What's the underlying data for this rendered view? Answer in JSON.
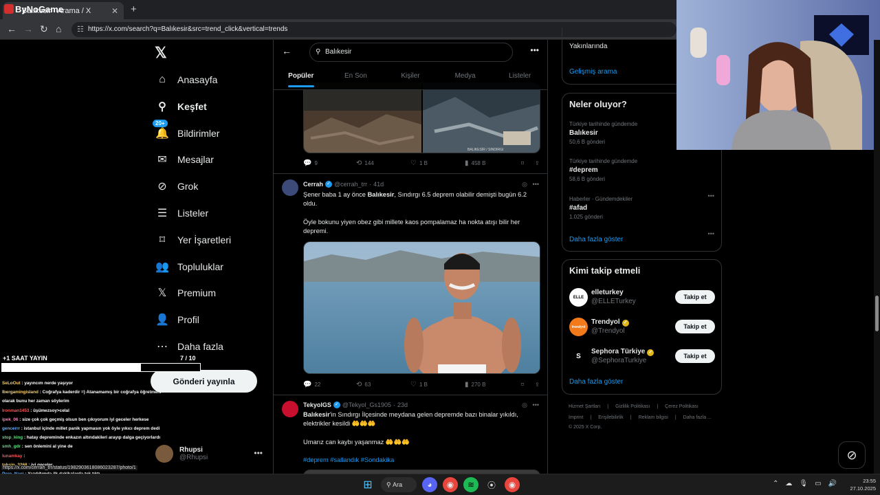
{
  "browser": {
    "tab_title": "Balıkesir - Arama / X",
    "url": "https://x.com/search?q=Balıkesir&src=trend_click&vertical=trends",
    "brand_logo_text": "ByNoGame"
  },
  "nav": {
    "items": [
      {
        "label": "Anasayfa",
        "icon": "home-icon"
      },
      {
        "label": "Keşfet",
        "icon": "search-icon"
      },
      {
        "label": "Bildirimler",
        "icon": "bell-icon",
        "badge": "20+"
      },
      {
        "label": "Mesajlar",
        "icon": "mail-icon"
      },
      {
        "label": "Grok",
        "icon": "grok-icon"
      },
      {
        "label": "Listeler",
        "icon": "list-icon"
      },
      {
        "label": "Yer İşaretleri",
        "icon": "bookmark-icon"
      },
      {
        "label": "Topluluklar",
        "icon": "communities-icon"
      },
      {
        "label": "Premium",
        "icon": "x-icon"
      },
      {
        "label": "Profil",
        "icon": "person-icon"
      },
      {
        "label": "Daha fazla",
        "icon": "more-circle-icon"
      }
    ],
    "post_button": "Gönderi yayınla",
    "account": {
      "name": "Rhupsi",
      "handle": "@Rhupsi"
    }
  },
  "overlay": {
    "title": "+1 SAAT YAYIN",
    "count": "7  / 10",
    "progress": 0.7,
    "chat": [
      {
        "user": "SeLoOut",
        "msg": "yayıncım nerde yaşıyor",
        "color": "u"
      },
      {
        "user": "Ibergamingisland",
        "msg": "Coğrafya kaderdir =) Atanamamış bir coğrafya öğretmeni",
        "color": "u"
      },
      {
        "user": "",
        "msg": "olarak bunu her zaman söylerim",
        "color": "u"
      },
      {
        "user": "Ironman1453",
        "msg": "üşümezsoy>celal",
        "color": "u r"
      },
      {
        "user": "ipek_06",
        "msg": "size çok çok geçmiş olsun ben çıkıyorum iyi geceler herkese",
        "color": "u p"
      },
      {
        "user": "gencerrr",
        "msg": "istanbul içinde millet panik yapmasın yok öyle yıkıcı deprem dedi",
        "color": "u b"
      },
      {
        "user": "stop_king",
        "msg": "hatay depreminde enkazın altındakileri arayıp dalga geçiyorlardı",
        "color": "u g"
      },
      {
        "user": "smh_gdr",
        "msg": "sen önlemini al yine de",
        "color": "u g"
      },
      {
        "user": "lunamkay",
        "msg": "",
        "color": "u r"
      },
      {
        "user": "tahsin_3268",
        "msg": "iyi geceler",
        "color": "u"
      },
      {
        "user": "Pero_Nagi",
        "msg": "Yazdığımda ilk dakikalarda tek tıktı",
        "color": "u b"
      },
      {
        "user": "smh_gdr",
        "msg": "ohoo neler neler yaptılar",
        "color": "u g"
      },
      {
        "user": "ipek_06",
        "msg": "iyi geceler",
        "color": "u p"
      }
    ],
    "url_tip": "https://x.com/cerrah_trr/status/1982903618086023287/photo/1"
  },
  "search": {
    "query": "Balıkesir",
    "tabs": [
      "Popüler",
      "En Son",
      "Kişiler",
      "Medya",
      "Listeler"
    ]
  },
  "tweets": [
    {
      "replies": "9",
      "retweets": "144",
      "likes": "1 B",
      "views": "458 B",
      "image_caption": "BALIKESİR / SINDIRGI"
    },
    {
      "name": "Cerrah",
      "handle": "@cerrah_trr",
      "time": "41d",
      "text1_pre": "Şener baba 1 ay önce ",
      "text1_bold": "Balıkesir",
      "text1_post": ", Sındırgı 6.5 deprem olabilir demişti bugün 6.2 oldu.",
      "text2": "Öyle bokunu yiyen obez gibi millete kaos pompalamaz ha nokta atışı bilir her depremi.",
      "replies": "22",
      "retweets": "63",
      "likes": "1 B",
      "views": "270 B"
    },
    {
      "name": "TekyolGS",
      "handle": "@Tekyol_Gs1905",
      "time": "23d",
      "text1_bold": "Balıkesir",
      "text1_post": "'in Sındırgı İlçesinde meydana gelen depremde bazı binalar yıkıldı, elektrikler kesildi 🤲🤲🤲",
      "text2": "Umarız can kaybı yaşanmaz 🤲🤲🤲",
      "hashtags": "#deprem #sallandık #Sondakika"
    }
  ],
  "right": {
    "top_text": "Yakınlarında",
    "advanced": "Gelişmiş arama",
    "trends_title": "Neler oluyor?",
    "trends": [
      {
        "context": "Türkiye tarihinde gündemde",
        "name": "Balıkesir",
        "posts": "50,6 B gönderi"
      },
      {
        "context": "Türkiye tarihinde gündemde",
        "name": "#deprem",
        "posts": "58,6 B gönderi"
      },
      {
        "context": "Haberler · Gündemdekiler",
        "name": "#afad",
        "posts": "1.025 gönderi"
      }
    ],
    "show_more": "Daha fazla göster",
    "who_title": "Kimi takip etmeli",
    "who": [
      {
        "name": "elleturkey",
        "handle": "@ELLETurkey",
        "button": "Takip et",
        "avatar_text": "ELLE"
      },
      {
        "name": "Trendyol",
        "handle": "@Trendyol",
        "button": "Takip et",
        "avatar_text": "trendyol"
      },
      {
        "name": "Sephora Türkiye",
        "handle": "@SephoraTurkiye",
        "button": "Takip et",
        "avatar_text": "S"
      }
    ],
    "who_more": "Daha fazla göster",
    "footer1": [
      "Hizmet Şartları",
      "Gizlilik Politikası",
      "Çerez Politikası"
    ],
    "footer2": [
      "Imprint",
      "Erişilebilirlik",
      "Reklam bilgisi",
      "Daha fazla ..."
    ],
    "copyright": "© 2025 X Corp."
  },
  "taskbar": {
    "search": "Ara",
    "time": "23:55",
    "date": "27.10.2025"
  }
}
